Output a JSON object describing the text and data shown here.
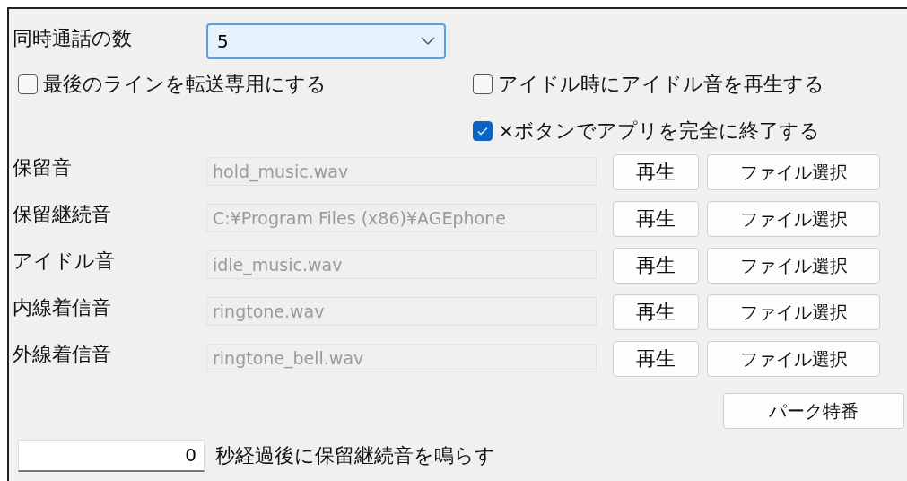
{
  "concurrent_calls": {
    "label": "同時通話の数",
    "value": "5"
  },
  "options": [
    {
      "label": "最後のラインを転送専用にする",
      "checked": false,
      "kind": "left"
    },
    {
      "label": "アイドル時にアイドル音を再生する",
      "checked": false,
      "kind": "right"
    },
    {
      "label": "×ボタンでアプリを完全に終了する",
      "checked": true,
      "kind": "right"
    }
  ],
  "sounds": [
    {
      "label": "保留音",
      "file": "hold_music.wav",
      "play_button": "再生",
      "select_button": "ファイル選択"
    },
    {
      "label": "保留継続音",
      "file": "C:¥Program Files (x86)¥AGEphone",
      "play_button": "再生",
      "select_button": "ファイル選択"
    },
    {
      "label": "アイドル音",
      "file": "idle_music.wav",
      "play_button": "再生",
      "select_button": "ファイル選択"
    },
    {
      "label": "内線着信音",
      "file": "ringtone.wav",
      "play_button": "再生",
      "select_button": "ファイル選択"
    },
    {
      "label": "外線着信音",
      "file": "ringtone_bell.wav",
      "play_button": "再生",
      "select_button": "ファイル選択"
    }
  ],
  "park_button": "パーク特番",
  "delay": {
    "value": "0",
    "label": "秒経過後に保留継続音を鳴らす"
  }
}
